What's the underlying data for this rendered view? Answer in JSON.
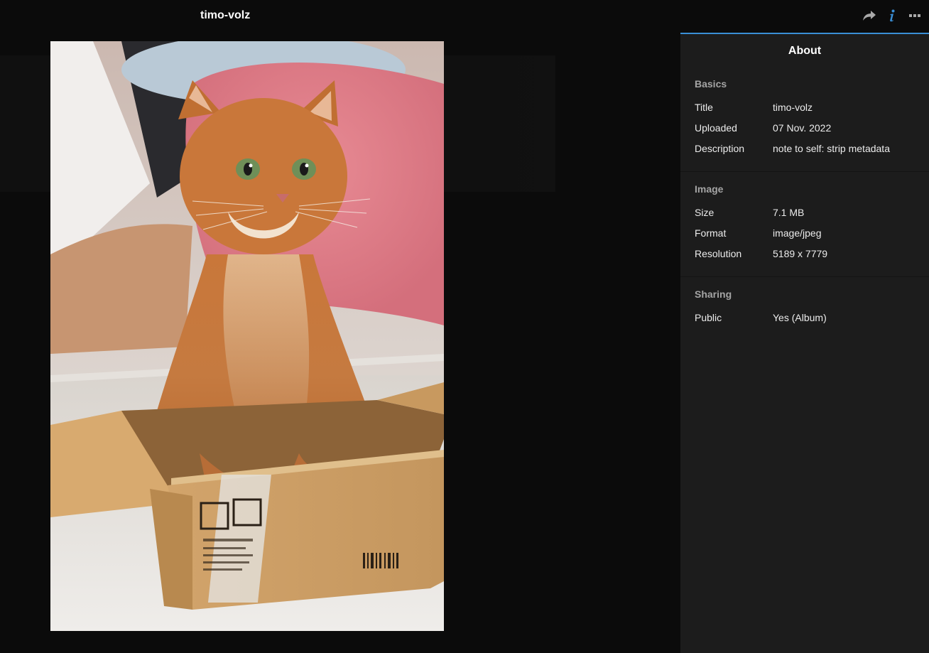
{
  "header": {
    "title": "timo-volz",
    "actions": [
      {
        "icon": "share-icon"
      },
      {
        "icon": "info-icon"
      },
      {
        "icon": "more-icon"
      }
    ]
  },
  "sidebar": {
    "title": "About",
    "sections": [
      {
        "heading": "Basics",
        "rows": [
          {
            "label": "Title",
            "value": "timo-volz"
          },
          {
            "label": "Uploaded",
            "value": "07 Nov. 2022"
          },
          {
            "label": "Description",
            "value": "note to self: strip metadata"
          }
        ]
      },
      {
        "heading": "Image",
        "rows": [
          {
            "label": "Size",
            "value": "7.1 MB"
          },
          {
            "label": "Format",
            "value": "image/jpeg"
          },
          {
            "label": "Resolution",
            "value": "5189 x 7779"
          }
        ]
      },
      {
        "heading": "Sharing",
        "rows": [
          {
            "label": "Public",
            "value": "Yes (Album)"
          }
        ]
      }
    ]
  },
  "colors": {
    "accent": "#3a8fd6",
    "background": "#0b0b0b",
    "panel": "#1c1c1c"
  }
}
